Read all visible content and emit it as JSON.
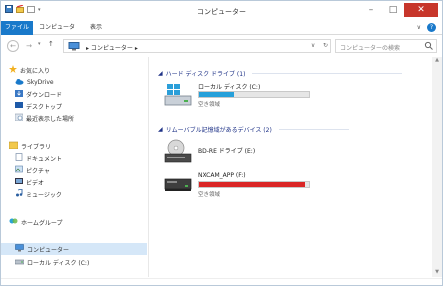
{
  "window": {
    "title": "コンピューター",
    "controls": {
      "minimize": "–",
      "maximize": "□",
      "close": "✕"
    }
  },
  "quick_access": [
    "quick-access-save",
    "quick-access-folder"
  ],
  "ribbon": {
    "tabs": [
      "ファイル",
      "コンピュータ",
      "表示"
    ],
    "expand_glyph": "∨",
    "help_glyph": "?"
  },
  "address": {
    "back": "←",
    "forward": "→",
    "up": "↑",
    "path": "▸ コンピューター ▸",
    "dropdown": "∨",
    "refresh": "↻"
  },
  "search": {
    "placeholder": "コンピューターの検索"
  },
  "nav": {
    "favorites": {
      "label": "お気に入り",
      "items": [
        "SkyDrive",
        "ダウンロード",
        "デスクトップ",
        "最近表示した場所"
      ]
    },
    "libraries": {
      "label": "ライブラリ",
      "items": [
        "ドキュメント",
        "ピクチャ",
        "ビデオ",
        "ミュージック"
      ]
    },
    "homegroup": "ホームグループ",
    "computer": {
      "label": "コンピューター",
      "items": [
        "ローカル ディスク (C:)"
      ]
    }
  },
  "groups": {
    "hdd": {
      "label": "ハード ディスク ドライブ (1)"
    },
    "removable": {
      "label": "リムーバブル記憶域があるデバイス (2)"
    }
  },
  "drives": [
    {
      "name": "ローカル ディスク (C:)",
      "sub": "空き領域",
      "used_fraction": 0.32,
      "color": "#26a0da"
    },
    {
      "name": "BD-RE ドライブ (E:)",
      "sub": ""
    },
    {
      "name": "NXCAM_APP (F:)",
      "sub": "空き領域",
      "used_fraction": 0.96,
      "color": "#da2626"
    }
  ],
  "colors": {
    "accent": "#1979ca",
    "selection": "#d5e7f8",
    "close": "#c7362b"
  }
}
